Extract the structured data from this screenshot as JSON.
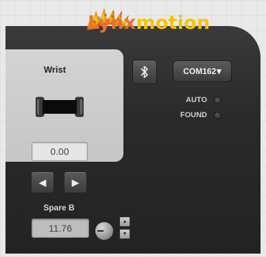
{
  "logo": {
    "text_a": "Lynx",
    "text_b": "motion"
  },
  "servo": {
    "title": "Wrist",
    "value": "0.00"
  },
  "connection": {
    "port_label": "COM162",
    "dropdown_arrow": "▾"
  },
  "status": [
    {
      "label": "AUTO",
      "on": false
    },
    {
      "label": "FOUND",
      "on": false
    }
  ],
  "nav": {
    "prev_icon": "◀",
    "next_icon": "▶"
  },
  "spare": {
    "label": "Spare B",
    "value": "11.76"
  },
  "stepper": {
    "up_icon": "▲",
    "down_icon": "▼"
  },
  "colors": {
    "panel": "#2a2a2a",
    "logo_orange": "#e8732a",
    "logo_yellow": "#f5c400"
  },
  "icons": [
    "bluetooth-icon",
    "chevron-left-icon",
    "chevron-right-icon"
  ]
}
